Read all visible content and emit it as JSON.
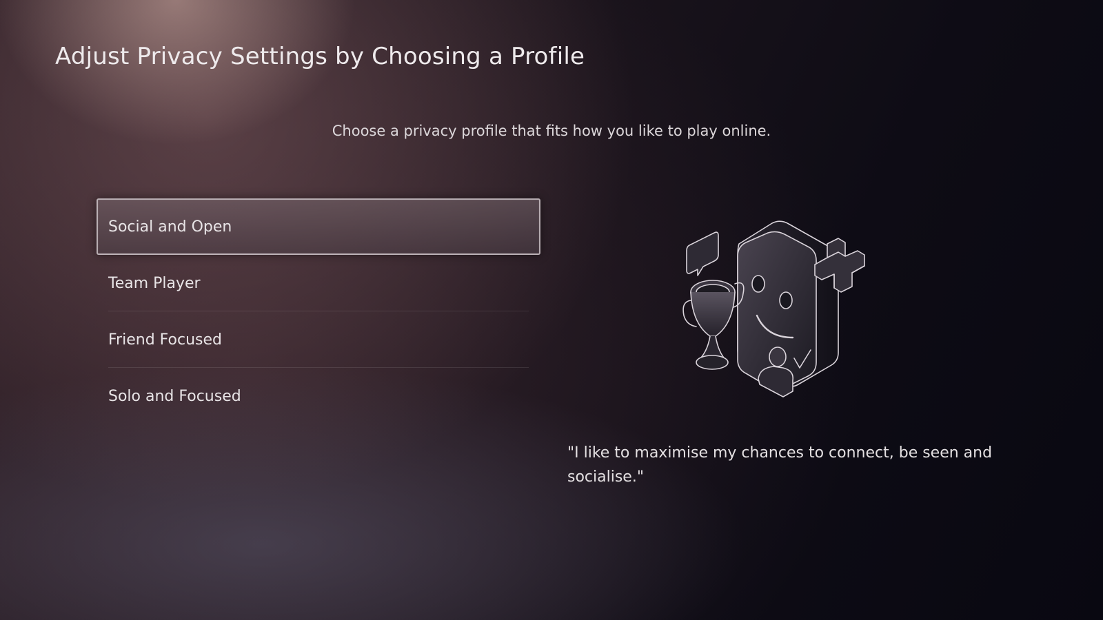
{
  "header": {
    "title": "Adjust Privacy Settings by Choosing a Profile"
  },
  "main": {
    "subtitle": "Choose a privacy profile that fits how you like to play online.",
    "profiles": [
      {
        "label": "Social and Open",
        "selected": true
      },
      {
        "label": "Team Player",
        "selected": false
      },
      {
        "label": "Friend Focused",
        "selected": false
      },
      {
        "label": "Solo and Focused",
        "selected": false
      }
    ],
    "illustration": {
      "icons": [
        "smiley-face-icon",
        "trophy-icon",
        "speech-bubble-icon",
        "plus-icon",
        "user-check-icon"
      ]
    },
    "description": "\"I like to maximise my chances to connect, be seen and socialise.\""
  },
  "colors": {
    "background": "#0d0b12",
    "text": "#e6e2e4",
    "selection_border": "#dcd4d8"
  }
}
